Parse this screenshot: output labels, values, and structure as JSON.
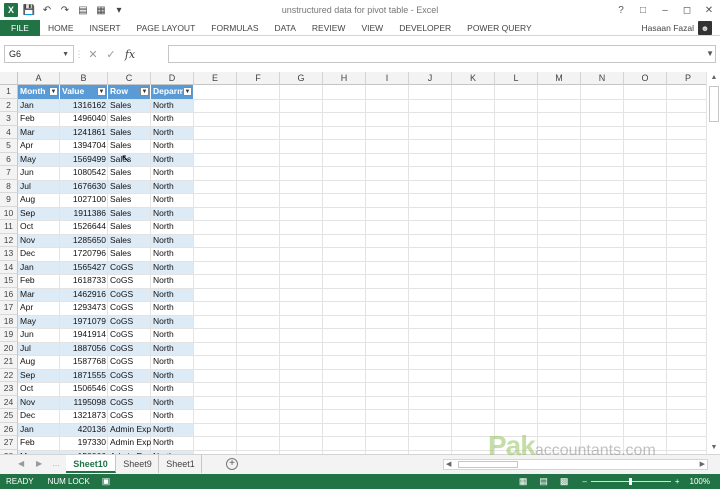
{
  "window": {
    "title": "unstructured data for pivot table - Excel",
    "help_label": "?"
  },
  "ribbon": {
    "file_label": "FILE",
    "tabs": [
      "HOME",
      "INSERT",
      "PAGE LAYOUT",
      "FORMULAS",
      "DATA",
      "REVIEW",
      "VIEW",
      "DEVELOPER",
      "POWER QUERY"
    ],
    "user_name": "Hasaan Fazal"
  },
  "formula_bar": {
    "name_box": "G6",
    "fx_label": "fx",
    "formula": ""
  },
  "columns": [
    "A",
    "B",
    "C",
    "D",
    "E",
    "F",
    "G",
    "H",
    "I",
    "J",
    "K",
    "L",
    "M",
    "N",
    "O",
    "P"
  ],
  "table": {
    "headers": [
      "Month",
      "Value",
      "Row",
      "Deparm"
    ],
    "rows": [
      [
        "Jan",
        "1316162",
        "Sales",
        "North"
      ],
      [
        "Feb",
        "1496040",
        "Sales",
        "North"
      ],
      [
        "Mar",
        "1241861",
        "Sales",
        "North"
      ],
      [
        "Apr",
        "1394704",
        "Sales",
        "North"
      ],
      [
        "May",
        "1569499",
        "Sales",
        "North"
      ],
      [
        "Jun",
        "1080542",
        "Sales",
        "North"
      ],
      [
        "Jul",
        "1676630",
        "Sales",
        "North"
      ],
      [
        "Aug",
        "1027100",
        "Sales",
        "North"
      ],
      [
        "Sep",
        "1911386",
        "Sales",
        "North"
      ],
      [
        "Oct",
        "1526644",
        "Sales",
        "North"
      ],
      [
        "Nov",
        "1285650",
        "Sales",
        "North"
      ],
      [
        "Dec",
        "1720796",
        "Sales",
        "North"
      ],
      [
        "Jan",
        "1565427",
        "CoGS",
        "North"
      ],
      [
        "Feb",
        "1618733",
        "CoGS",
        "North"
      ],
      [
        "Mar",
        "1462916",
        "CoGS",
        "North"
      ],
      [
        "Apr",
        "1293473",
        "CoGS",
        "North"
      ],
      [
        "May",
        "1971079",
        "CoGS",
        "North"
      ],
      [
        "Jun",
        "1941914",
        "CoGS",
        "North"
      ],
      [
        "Jul",
        "1887056",
        "CoGS",
        "North"
      ],
      [
        "Aug",
        "1587768",
        "CoGS",
        "North"
      ],
      [
        "Sep",
        "1871555",
        "CoGS",
        "North"
      ],
      [
        "Oct",
        "1506546",
        "CoGS",
        "North"
      ],
      [
        "Nov",
        "1195098",
        "CoGS",
        "North"
      ],
      [
        "Dec",
        "1321873",
        "CoGS",
        "North"
      ],
      [
        "Jan",
        "420136",
        "Admin Exp",
        "North"
      ],
      [
        "Feb",
        "197330",
        "Admin Exp",
        "North"
      ],
      [
        "Mar",
        "158066",
        "Admin Exp",
        "North"
      ]
    ]
  },
  "sheets": [
    "Sheet10",
    "Sheet9",
    "Sheet1"
  ],
  "active_sheet": "Sheet10",
  "status": {
    "ready": "READY",
    "num_lock": "NUM LOCK",
    "zoom": "100%"
  },
  "watermark": {
    "brand": "Pak",
    "suffix": "accountants.com"
  },
  "colors": {
    "excel_green": "#217346",
    "table_header": "#5b9bd5",
    "table_band": "#ddebf7"
  }
}
